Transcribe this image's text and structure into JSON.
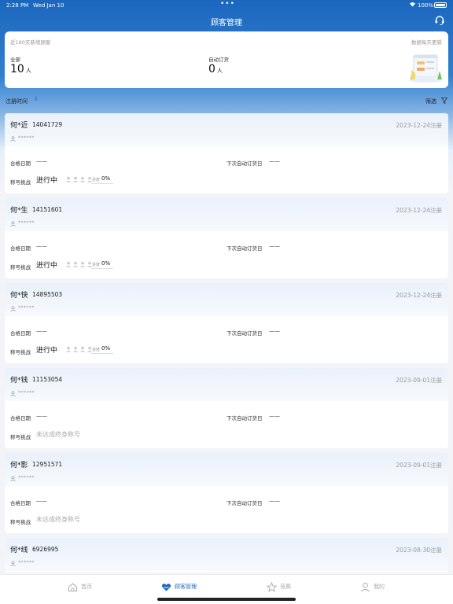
{
  "status_bar": {
    "time": "2:28 PM",
    "date": "Wed Jan 10",
    "dots": "•••",
    "battery": "100%"
  },
  "header": {
    "title": "顾客管理",
    "support_icon": "headset-icon"
  },
  "summary": {
    "subtitle": "近180天新增顾客",
    "update_note": "数据每天更新",
    "all_label": "全部",
    "all_value": "10",
    "all_unit": "人",
    "auto_label": "自动订货",
    "auto_value": "0",
    "auto_unit": "人"
  },
  "filter_bar": {
    "sort_label": "注册时间",
    "sort_icon": "sort-down-icon",
    "filter_label": "筛选",
    "filter_icon": "funnel-icon"
  },
  "labels": {
    "qualify_date": "合格日期",
    "next_auto_order": "下次自动订货日",
    "title_challenge": "称号挑战",
    "dash": "——",
    "progress_label": "进度"
  },
  "customers": [
    {
      "name": "何*近",
      "phone": "14041729",
      "registered": "2023-12-24注册",
      "masked": "******",
      "qualify_date": "——",
      "next_order": "——",
      "challenge_status": "进行中",
      "progress": "0%",
      "in_progress": true
    },
    {
      "name": "何*生",
      "phone": "14151601",
      "registered": "2023-12-24注册",
      "masked": "******",
      "qualify_date": "——",
      "next_order": "——",
      "challenge_status": "进行中",
      "progress": "0%",
      "in_progress": true
    },
    {
      "name": "何*快",
      "phone": "14895503",
      "registered": "2023-12-24注册",
      "masked": "******",
      "qualify_date": "——",
      "next_order": "——",
      "challenge_status": "进行中",
      "progress": "0%",
      "in_progress": true
    },
    {
      "name": "何*钱",
      "phone": "11153054",
      "registered": "2023-09-01注册",
      "masked": "******",
      "qualify_date": "——",
      "next_order": "——",
      "challenge_status": "未达成终身称号",
      "progress": "",
      "in_progress": false
    },
    {
      "name": "何*影",
      "phone": "12951571",
      "registered": "2023-09-01注册",
      "masked": "******",
      "qualify_date": "——",
      "next_order": "——",
      "challenge_status": "未达成终身称号",
      "progress": "",
      "in_progress": false
    },
    {
      "name": "何*线",
      "phone": "6926995",
      "registered": "2023-08-30注册",
      "masked": "******",
      "qualify_date": "——",
      "next_order": "——",
      "challenge_status": "",
      "progress": "",
      "in_progress": false
    }
  ],
  "tabbar": {
    "items": [
      {
        "label": "首页",
        "icon": "home-icon",
        "active": false
      },
      {
        "label": "顾客管理",
        "icon": "customer-heart-icon",
        "active": true
      },
      {
        "label": "竞赛",
        "icon": "star-icon",
        "active": false
      },
      {
        "label": "我的",
        "icon": "profile-icon",
        "active": false
      }
    ]
  },
  "colors": {
    "primary": "#1c67be",
    "muted": "#999999",
    "background": "#f2f4f7"
  }
}
